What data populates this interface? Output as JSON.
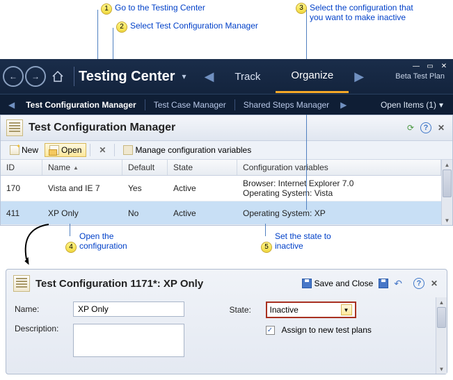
{
  "callouts": {
    "c1": "Go to the Testing Center",
    "c2": "Select Test Configuration Manager",
    "c3": "Select the configuration that you want to make inactive",
    "c4": "Open the configuration",
    "c5": "Set the state to inactive"
  },
  "header": {
    "title": "Testing Center",
    "tabs": {
      "track": "Track",
      "organize": "Organize"
    },
    "plan": "Beta Test Plan"
  },
  "subnav": {
    "tcm": "Test Configuration Manager",
    "case": "Test Case Manager",
    "steps": "Shared Steps Manager",
    "openitems": "Open Items (1)"
  },
  "panel": {
    "title": "Test Configuration Manager",
    "toolbar": {
      "new": "New",
      "open": "Open",
      "vars": "Manage configuration variables"
    },
    "cols": {
      "id": "ID",
      "name": "Name",
      "default": "Default",
      "state": "State",
      "cvars": "Configuration variables"
    },
    "rows": [
      {
        "id": "170",
        "name": "Vista and IE 7",
        "default": "Yes",
        "state": "Active",
        "cvars": "Browser: Internet Explorer 7.0\nOperating System: Vista"
      },
      {
        "id": "411",
        "name": "XP Only",
        "default": "No",
        "state": "Active",
        "cvars": "Operating System: XP"
      }
    ]
  },
  "editor": {
    "title": "Test Configuration 1171*: XP Only",
    "save_close": "Save and Close",
    "name_label": "Name:",
    "name_value": "XP Only",
    "desc_label": "Description:",
    "state_label": "State:",
    "state_value": "Inactive",
    "assign_label": "Assign to new test plans"
  }
}
